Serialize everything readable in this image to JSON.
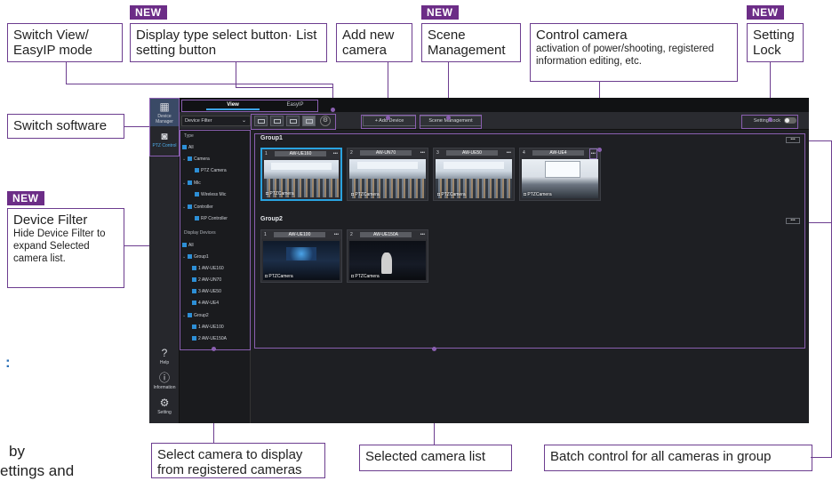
{
  "callouts": {
    "switch_view": "Switch View/ EasyIP mode",
    "display_type": "Display type select button· List setting button",
    "add_camera": "Add new camera",
    "scene_management": "Scene Management",
    "control_camera_title": "Control camera",
    "control_camera_sub": "activation of power/shooting, registered information editing, etc.",
    "setting_lock": "Setting Lock",
    "switch_software": "Switch software",
    "device_filter_title": "Device Filter",
    "device_filter_sub": "Hide Device Filter to expand Selected camera list.",
    "select_camera": "Select camera to display from registered cameras",
    "selected_list": "Selected camera list",
    "batch_control": "Batch control for all cameras in group"
  },
  "new_tag": "NEW",
  "stray_text": {
    "colon": ":",
    "by": "by",
    "settings_and": "ettings and"
  },
  "app": {
    "rail": {
      "device_manager": "Device Manager",
      "ptz_control": "PTZ Control",
      "help": "Help",
      "information": "Information",
      "setting": "Setting"
    },
    "tabs": {
      "view": "View",
      "easyip": "EasyIP"
    },
    "toolbar": {
      "device_filter": "Device Filter",
      "add_device": "+ Add Device",
      "scene_management": "Scene Management",
      "setting_lock": "Setting Lock"
    },
    "filter": {
      "type_head": "Type",
      "all": "All",
      "camera": "Camera",
      "ptz_camera": "PTZ Camera",
      "mic": "Mic",
      "wireless_mic": "Wireless Mic",
      "controller": "Controller",
      "rp_controller": "RP Controller",
      "display_head": "Display Devices",
      "all2": "All",
      "group1": "Group1",
      "g1_items": [
        "1  AW-UE160",
        "2  AW-UN70",
        "3  AW-UE50",
        "4  AW-UE4"
      ],
      "group2": "Group2",
      "g2_items": [
        "1  AW-UE100",
        "2  AW-UE150A"
      ]
    },
    "groups": [
      {
        "title": "Group1",
        "more": "•••",
        "cards": [
          {
            "num": "1",
            "name": "AW-UE160",
            "more": "•••",
            "foot": "PTZCamera"
          },
          {
            "num": "2",
            "name": "AW-UN70",
            "more": "•••",
            "foot": "PTZCamera"
          },
          {
            "num": "3",
            "name": "AW-UE50",
            "more": "•••",
            "foot": "PTZCamera"
          },
          {
            "num": "4",
            "name": "AW-UE4",
            "more": "•••",
            "foot": "PTZCamera"
          }
        ]
      },
      {
        "title": "Group2",
        "more": "•••",
        "cards": [
          {
            "num": "1",
            "name": "AW-UE100",
            "more": "•••",
            "foot": "PTZCamera"
          },
          {
            "num": "2",
            "name": "AW-UE150A",
            "more": "•••",
            "foot": "PTZCamera"
          }
        ]
      }
    ]
  },
  "colors": {
    "accent": "#6c2d87",
    "select": "#2aa3e0",
    "checkbox": "#2d8fd6"
  }
}
